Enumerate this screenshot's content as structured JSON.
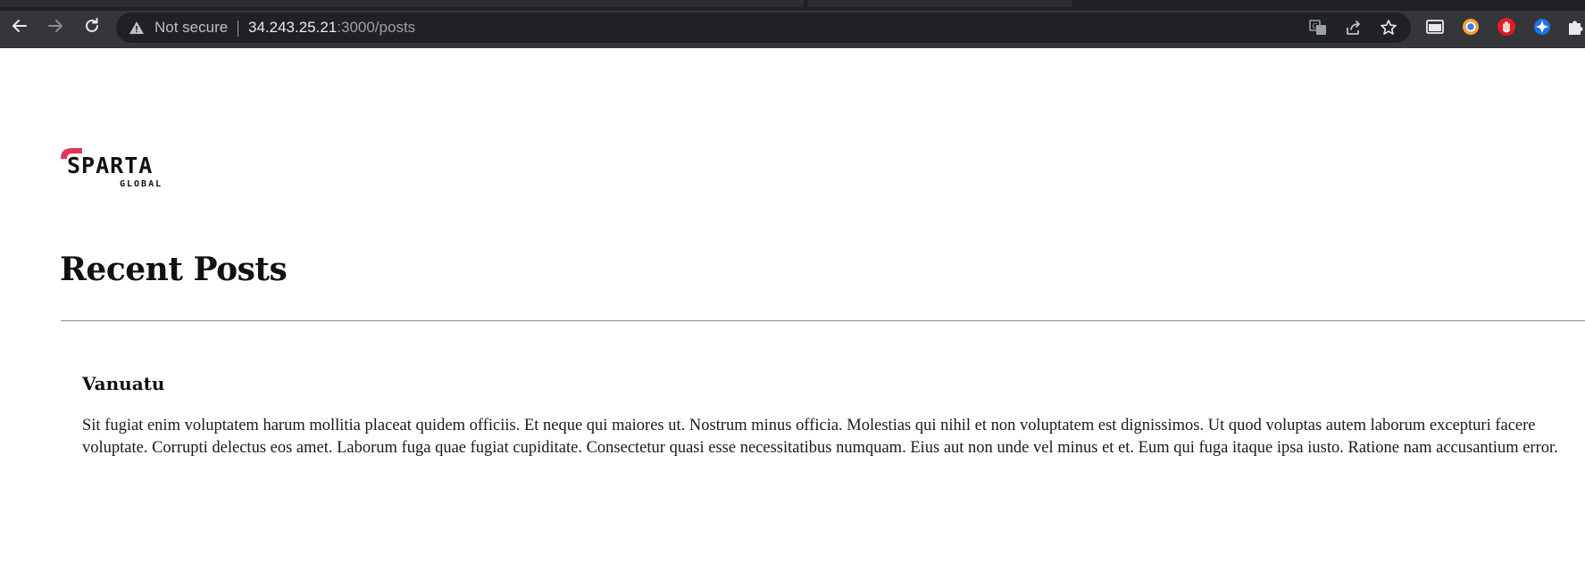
{
  "browser": {
    "security_label": "Not secure",
    "url_host": "34.243.25.21",
    "url_path": ":3000/posts",
    "nav_icons": [
      "back-arrow-icon",
      "forward-arrow-icon",
      "reload-icon"
    ],
    "omnibox_icons": [
      "warning-icon",
      "translate-icon",
      "share-icon",
      "star-icon"
    ],
    "toolbar_icons": [
      "reading-mode-icon",
      "browser-extension-icon",
      "stop-hand-extension-icon",
      "blue-shield-extension-icon",
      "puzzle-extensions-icon"
    ],
    "colors": {
      "frame": "#35363a",
      "omnibox": "#202124",
      "text": "#e8eaed"
    }
  },
  "page": {
    "logo": {
      "name": "sparta-global-logo",
      "text_main": "SPARTA",
      "text_sub": "GLOBAL",
      "accent": "#e6335a"
    },
    "title": "Recent Posts",
    "posts": [
      {
        "title": "Vanuatu",
        "body": "Sit fugiat enim voluptatem harum mollitia placeat quidem officiis. Et neque qui maiores ut. Nostrum minus officia. Molestias qui nihil et non voluptatem est dignissimos. Ut quod voluptas autem laborum excepturi facere voluptate. Corrupti delectus eos amet. Laborum fuga quae fugiat cupiditate. Consectetur quasi esse necessitatibus numquam. Eius aut non unde vel minus et et. Eum qui fuga itaque ipsa iusto. Ratione nam accusantium error."
      }
    ]
  }
}
